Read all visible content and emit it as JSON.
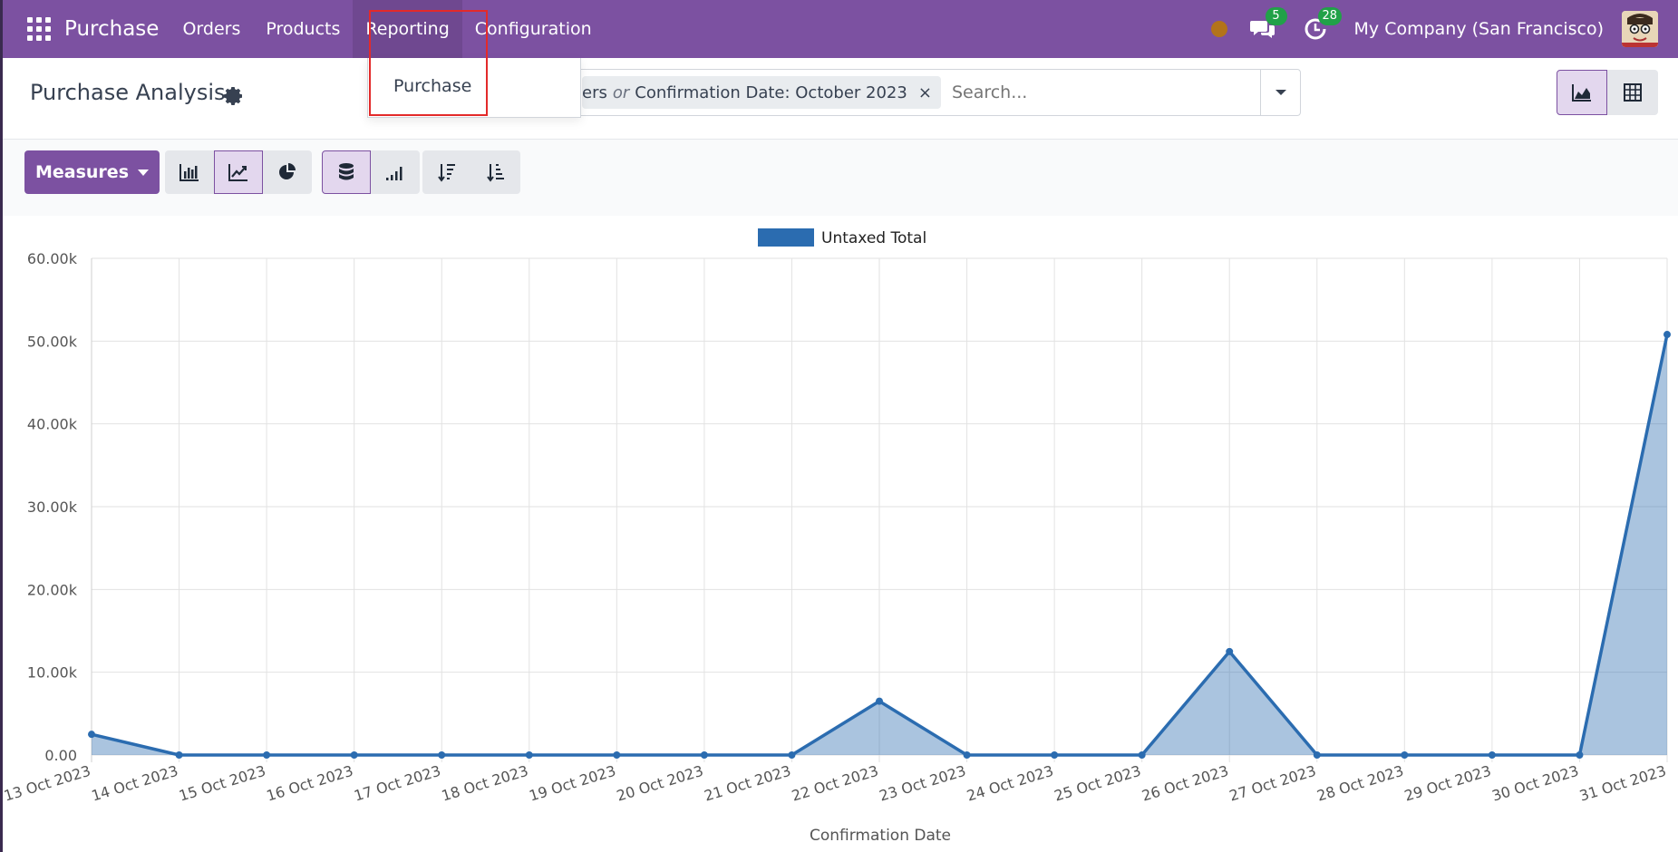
{
  "navbar": {
    "brand": "Purchase",
    "menu": [
      {
        "label": "Orders",
        "name": "nav-orders"
      },
      {
        "label": "Products",
        "name": "nav-products"
      },
      {
        "label": "Reporting",
        "name": "nav-reporting"
      },
      {
        "label": "Configuration",
        "name": "nav-configuration"
      }
    ],
    "messages_count": "5",
    "activities_count": "28",
    "company": "My Company (San Francisco)"
  },
  "dropdown": {
    "items": [
      "Purchase"
    ]
  },
  "control_panel": {
    "title": "Purchase Analysis",
    "facet": {
      "left": "ers",
      "sep": "or",
      "right": "Confirmation Date: October 2023",
      "close": "×"
    },
    "search_placeholder": "Search..."
  },
  "toolbar": {
    "measures_label": "Measures"
  },
  "colors": {
    "brand": "#7c51a1",
    "series": "#2b6cb0",
    "badge": "#21a148",
    "highlight": "#e32a2a"
  },
  "chart_data": {
    "type": "area",
    "xlabel": "Confirmation Date",
    "ylabel": "",
    "ylim": [
      0,
      60000
    ],
    "yticks": [
      "0.00",
      "10.00k",
      "20.00k",
      "30.00k",
      "40.00k",
      "50.00k",
      "60.00k"
    ],
    "legend_position": "top-center",
    "grid": true,
    "categories": [
      "13 Oct 2023",
      "14 Oct 2023",
      "15 Oct 2023",
      "16 Oct 2023",
      "17 Oct 2023",
      "18 Oct 2023",
      "19 Oct 2023",
      "20 Oct 2023",
      "21 Oct 2023",
      "22 Oct 2023",
      "23 Oct 2023",
      "24 Oct 2023",
      "25 Oct 2023",
      "26 Oct 2023",
      "27 Oct 2023",
      "28 Oct 2023",
      "29 Oct 2023",
      "30 Oct 2023",
      "31 Oct 2023"
    ],
    "series": [
      {
        "name": "Untaxed Total",
        "values": [
          2500,
          0,
          0,
          0,
          0,
          0,
          0,
          0,
          0,
          6500,
          0,
          0,
          0,
          12500,
          0,
          0,
          0,
          0,
          50800
        ]
      }
    ]
  }
}
